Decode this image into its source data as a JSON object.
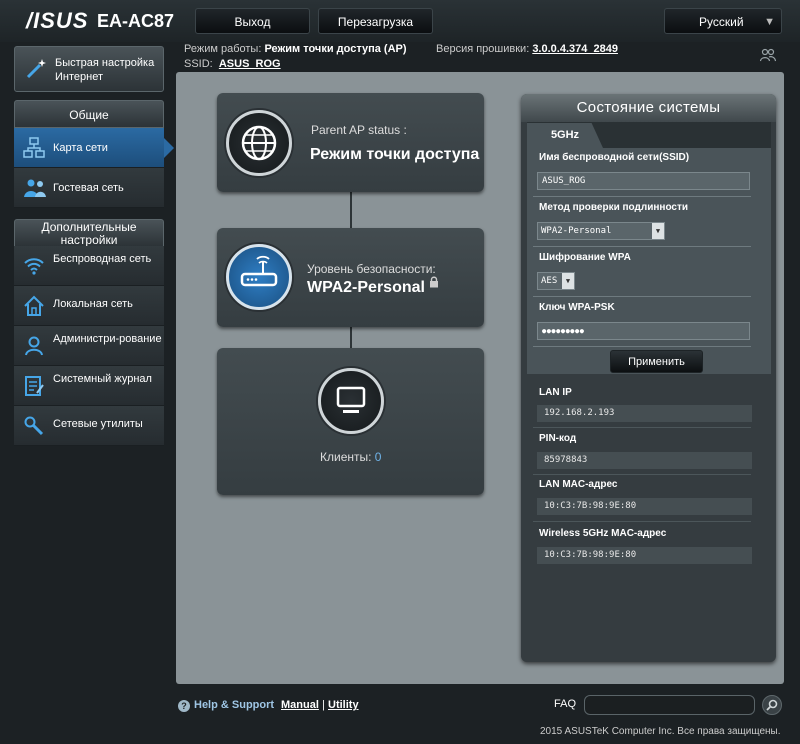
{
  "header": {
    "logo": "/ISUS",
    "model": "EA-AC87",
    "logout_label": "Выход",
    "reboot_label": "Перезагрузка",
    "language": "Русский"
  },
  "status_line": {
    "mode_label": "Режим работы:",
    "mode_value": "Режим точки доступа (AP)",
    "firmware_label": "Версия прошивки:",
    "firmware_value": "3.0.0.4.374_2849",
    "ssid_label": "SSID:",
    "ssid_value": "ASUS_ROG"
  },
  "sidebar": {
    "quick_setup": "Быстрая настройка Интернет",
    "general_header": "Общие",
    "general_items": [
      {
        "label": "Карта сети",
        "icon": "network-map-icon",
        "active": true
      },
      {
        "label": "Гостевая сеть",
        "icon": "guest-network-icon",
        "active": false
      }
    ],
    "advanced_header": "Дополнительные настройки",
    "advanced_items": [
      {
        "label": "Беспроводная сеть",
        "icon": "wireless-icon"
      },
      {
        "label": "Локальная сеть",
        "icon": "lan-icon"
      },
      {
        "label": "Администри-рование",
        "icon": "admin-icon"
      },
      {
        "label": "Системный журнал",
        "icon": "syslog-icon"
      },
      {
        "label": "Сетевые утилиты",
        "icon": "tools-icon"
      }
    ]
  },
  "network_map": {
    "parent_ap_label": "Parent AP status :",
    "parent_ap_value": "Режим точки доступа",
    "security_label": "Уровень безопасности:",
    "security_value": "WPA2-Personal",
    "clients_label": "Клиенты:",
    "clients_count": "0"
  },
  "system_status": {
    "title": "Состояние системы",
    "tab": "5GHz",
    "ssid_label": "Имя беспроводной сети(SSID)",
    "ssid_value": "ASUS_ROG",
    "auth_label": "Метод проверки подлинности",
    "auth_value": "WPA2-Personal",
    "encryption_label": "Шифрование WPA",
    "encryption_value": "AES",
    "psk_label": "Ключ WPA-PSK",
    "psk_value": "●●●●●●●●●",
    "apply_label": "Применить",
    "lan_ip_label": "LAN IP",
    "lan_ip_value": "192.168.2.193",
    "pin_label": "PIN-код",
    "pin_value": "85978843",
    "lan_mac_label": "LAN MAC-адрес",
    "lan_mac_value": "10:C3:7B:98:9E:80",
    "wireless_mac_label": "Wireless 5GHz MAC-адрес",
    "wireless_mac_value": "10:C3:7B:98:9E:80"
  },
  "footer": {
    "help": "Help & Support",
    "manual": "Manual",
    "utility": "Utility",
    "separator": "|",
    "faq": "FAQ",
    "copyright": "2015 ASUSTeK Computer Inc. Все права защищены."
  }
}
